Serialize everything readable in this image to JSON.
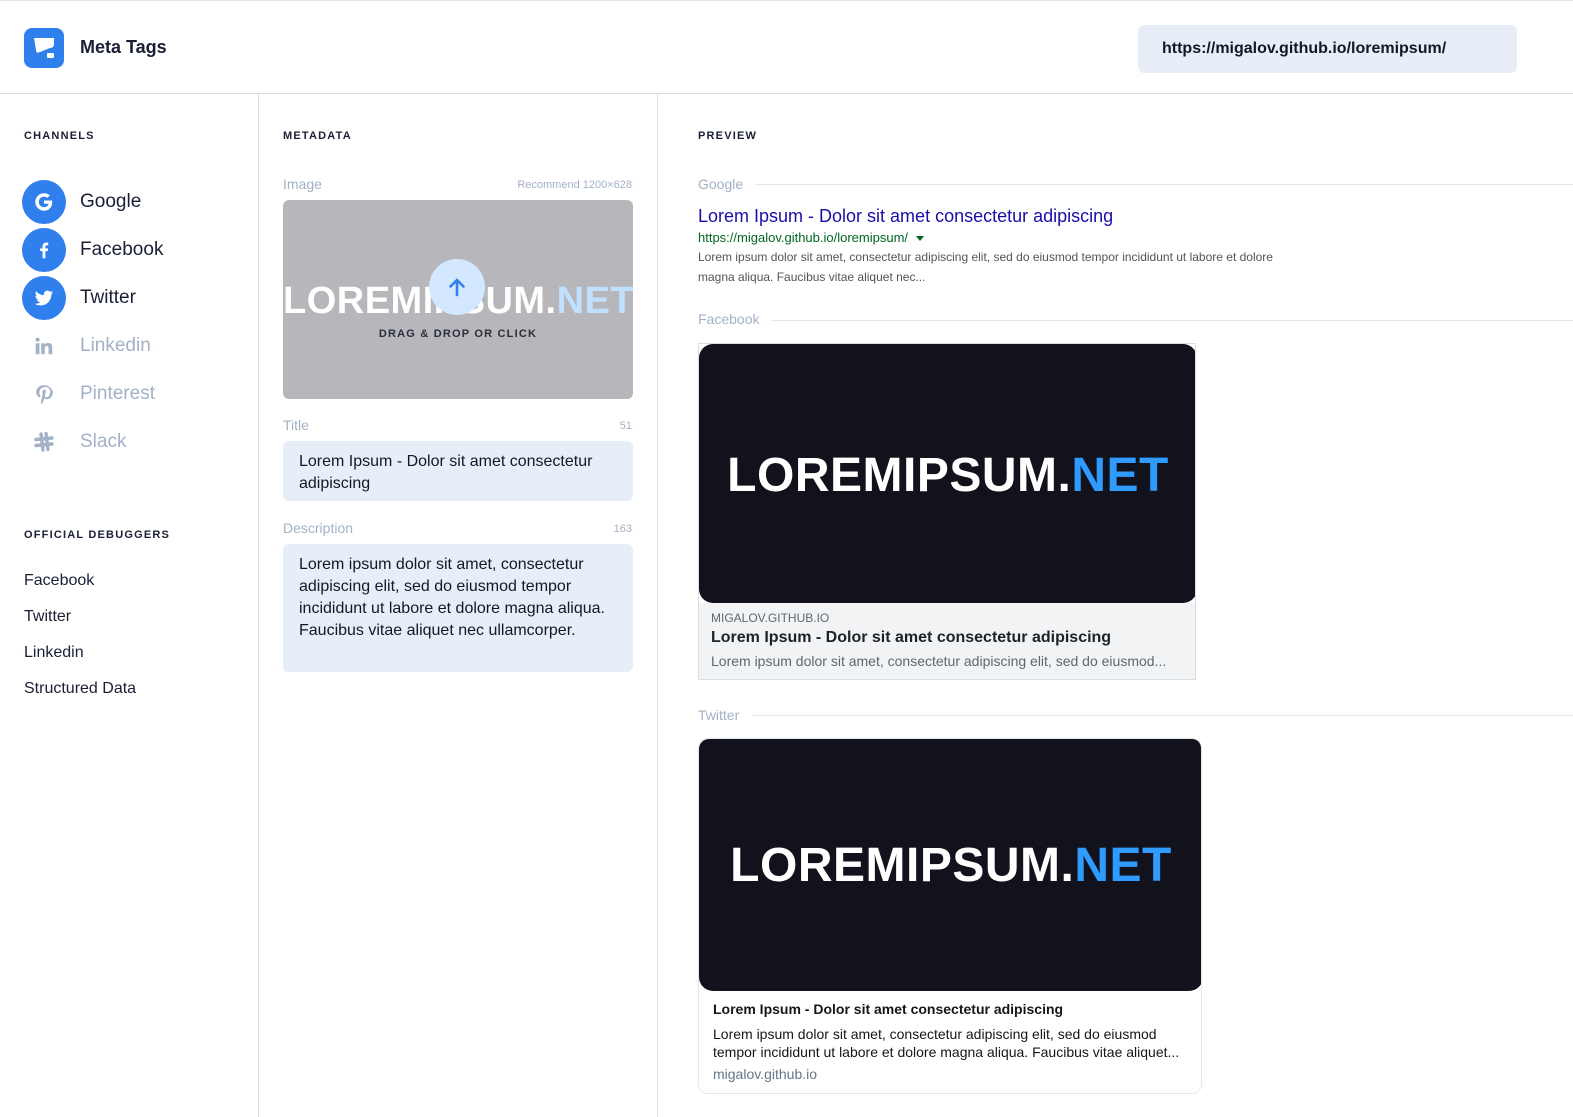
{
  "header": {
    "brand": "Meta Tags",
    "url": "https://migalov.github.io/loremipsum/"
  },
  "channels": {
    "title": "CHANNELS",
    "items": [
      {
        "label": "Google",
        "icon": "google-icon",
        "active": true
      },
      {
        "label": "Facebook",
        "icon": "facebook-icon",
        "active": true
      },
      {
        "label": "Twitter",
        "icon": "twitter-icon",
        "active": true
      },
      {
        "label": "Linkedin",
        "icon": "linkedin-icon",
        "active": false
      },
      {
        "label": "Pinterest",
        "icon": "pinterest-icon",
        "active": false
      },
      {
        "label": "Slack",
        "icon": "slack-icon",
        "active": false
      }
    ]
  },
  "debuggers": {
    "title": "OFFICIAL DEBUGGERS",
    "items": [
      "Facebook",
      "Twitter",
      "Linkedin",
      "Structured Data"
    ]
  },
  "metadata": {
    "title": "METADATA",
    "image_label": "Image",
    "image_hint": "Recommend 1200×628",
    "image_logo_main": "LOREMIPSUM.",
    "image_logo_accent": "NET",
    "upload_text": "DRAG & DROP OR CLICK",
    "title_label": "Title",
    "title_count": "51",
    "title_value": "Lorem Ipsum - Dolor sit amet consectetur adipiscing",
    "description_label": "Description",
    "description_count": "163",
    "description_value": "Lorem ipsum dolor sit amet, consectetur adipiscing elit, sed do eiusmod tempor incididunt ut labore et dolore magna aliqua. Faucibus vitae aliquet nec ullamcorper."
  },
  "preview": {
    "title": "PREVIEW",
    "google": {
      "label": "Google",
      "title": "Lorem Ipsum - Dolor sit amet consectetur adipiscing",
      "url": "https://migalov.github.io/loremipsum/",
      "description": "Lorem ipsum dolor sit amet, consectetur adipiscing elit, sed do eiusmod tempor incididunt ut labore et dolore magna aliqua. Faucibus vitae aliquet nec..."
    },
    "facebook": {
      "label": "Facebook",
      "domain": "MIGALOV.GITHUB.IO",
      "title": "Lorem Ipsum - Dolor sit amet consectetur adipiscing",
      "description": "Lorem ipsum dolor sit amet, consectetur adipiscing elit, sed do eiusmod..."
    },
    "twitter": {
      "label": "Twitter",
      "title": "Lorem Ipsum - Dolor sit amet consectetur adipiscing",
      "description": "Lorem ipsum dolor sit amet, consectetur adipiscing elit, sed do eiusmod tempor incididunt ut labore et dolore magna aliqua. Faucibus vitae aliquet...",
      "domain": "migalov.github.io"
    }
  },
  "colors": {
    "accent": "#2f80ed",
    "muted": "#a3b1c6",
    "image_bg": "#12121c",
    "google_link": "#1a0dab",
    "google_url": "#006621"
  }
}
